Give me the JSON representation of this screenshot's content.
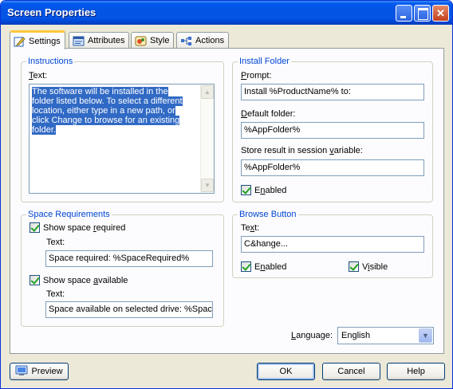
{
  "window": {
    "title": "Screen Properties"
  },
  "tabs": [
    {
      "label": "Settings",
      "icon": "pencil-icon"
    },
    {
      "label": "Attributes",
      "icon": "attributes-icon"
    },
    {
      "label": "Style",
      "icon": "style-icon"
    },
    {
      "label": "Actions",
      "icon": "actions-icon"
    }
  ],
  "instructions": {
    "legend": "Instructions",
    "text_label": "Text:",
    "text_value": "The software will be installed in the folder listed below. To select a different location, either type in a new path, or click Change to browse for an existing folder."
  },
  "install_folder": {
    "legend": "Install Folder",
    "prompt_label": "Prompt:",
    "prompt_value": "Install %ProductName% to:",
    "default_label": "Default folder:",
    "default_value": "%AppFolder%",
    "store_label": "Store result in session variable:",
    "store_value": "%AppFolder%",
    "enabled_label": "Enabled",
    "enabled_checked": true
  },
  "space_requirements": {
    "legend": "Space Requirements",
    "show_required_label": "Show space required",
    "show_required_checked": true,
    "required_text_label": "Text:",
    "required_text_value": "Space required: %SpaceRequired%",
    "show_available_label": "Show space available",
    "show_available_checked": true,
    "available_text_label": "Text:",
    "available_text_value": "Space available on selected drive: %Spac"
  },
  "browse_button": {
    "legend": "Browse Button",
    "text_label": "Text:",
    "text_value": "C&hange...",
    "enabled_label": "Enabled",
    "enabled_checked": true,
    "visible_label": "Visible",
    "visible_checked": true
  },
  "language": {
    "label": "Language:",
    "value": "English"
  },
  "buttons": {
    "preview": "Preview",
    "ok": "OK",
    "cancel": "Cancel",
    "help": "Help"
  },
  "colors": {
    "accent": "#0046d5",
    "selection": "#316ac5",
    "tab_highlight": "#ffc83c"
  }
}
